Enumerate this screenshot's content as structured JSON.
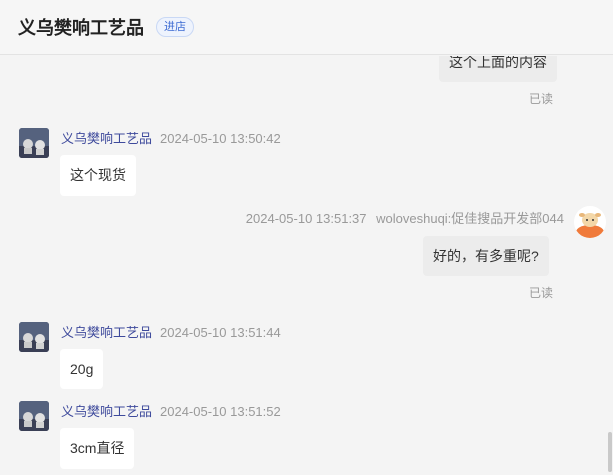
{
  "header": {
    "shop_name": "义乌樊响工艺品",
    "enter_shop_label": "进店"
  },
  "messages": [
    {
      "text": "这个上面的内容",
      "status": "已读"
    },
    {
      "sender": "义乌樊响工艺品",
      "time": "2024-05-10 13:50:42",
      "text": "这个现货"
    },
    {
      "time": "2024-05-10 13:51:37",
      "sender": "woloveshuqi:促佳搜品开发部044",
      "text": "好的，有多重呢?",
      "status": "已读"
    },
    {
      "sender": "义乌樊响工艺品",
      "time": "2024-05-10 13:51:44",
      "text": "20g"
    },
    {
      "sender": "义乌樊响工艺品",
      "time": "2024-05-10 13:51:52",
      "text": "3cm直径"
    }
  ],
  "colors": {
    "sender_name": "#3e4a9c",
    "enter_shop_badge": "#3d6bd3",
    "avatar_self": "#f07a3a"
  }
}
